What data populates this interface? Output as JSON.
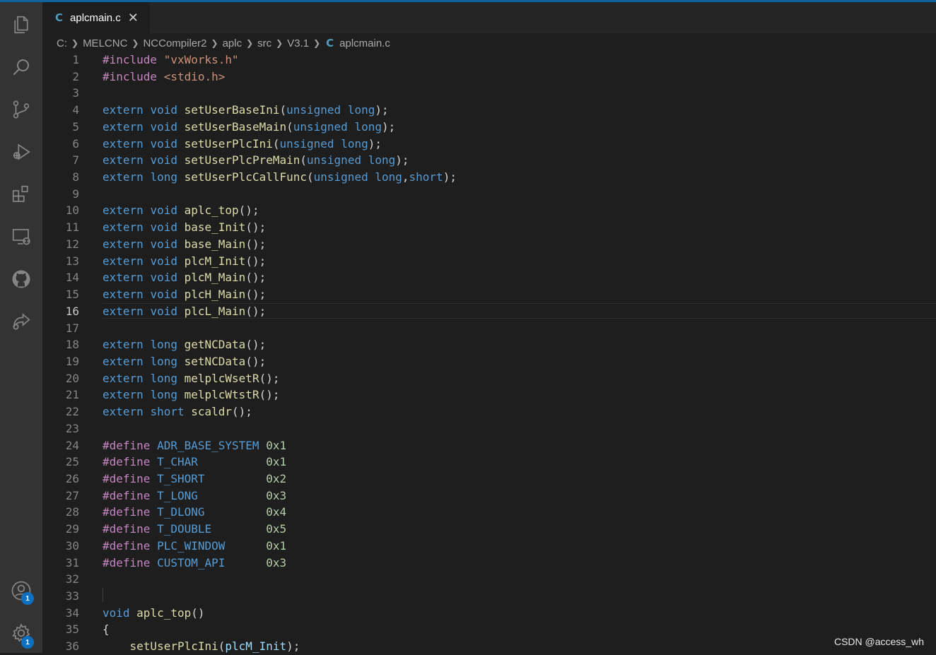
{
  "tab": {
    "icon": "c-language-icon",
    "glyph": "C",
    "filename": "aplcmain.c",
    "close": "✕"
  },
  "breadcrumb": {
    "items": [
      "C:",
      "MELCNC",
      "NCCompiler2",
      "aplc",
      "src",
      "V3.1"
    ],
    "file_glyph": "C",
    "file": "aplcmain.c"
  },
  "activity_bar": {
    "icons": [
      "explorer-icon",
      "search-icon",
      "source-control-icon",
      "run-debug-icon",
      "extensions-icon",
      "remote-explorer-icon",
      "github-icon",
      "live-share-icon",
      "accounts-icon",
      "manage-gear-icon"
    ],
    "accounts_badge": "1",
    "manage_badge": "1"
  },
  "editor": {
    "active_line": 16,
    "lines": [
      {
        "n": "1",
        "tokens": [
          [
            "#include ",
            "pp"
          ],
          [
            "\"vxWorks.h\"",
            "str"
          ]
        ]
      },
      {
        "n": "2",
        "tokens": [
          [
            "#include ",
            "pp"
          ],
          [
            "<stdio.h>",
            "str"
          ]
        ]
      },
      {
        "n": "3",
        "tokens": []
      },
      {
        "n": "4",
        "tokens": [
          [
            "extern ",
            "kw"
          ],
          [
            "void ",
            "kw"
          ],
          [
            "setUserBaseIni",
            "fn"
          ],
          [
            "(",
            "pl"
          ],
          [
            "unsigned ",
            "kw"
          ],
          [
            "long",
            "kw"
          ],
          [
            ");",
            "pl"
          ]
        ]
      },
      {
        "n": "5",
        "tokens": [
          [
            "extern ",
            "kw"
          ],
          [
            "void ",
            "kw"
          ],
          [
            "setUserBaseMain",
            "fn"
          ],
          [
            "(",
            "pl"
          ],
          [
            "unsigned ",
            "kw"
          ],
          [
            "long",
            "kw"
          ],
          [
            ");",
            "pl"
          ]
        ]
      },
      {
        "n": "6",
        "tokens": [
          [
            "extern ",
            "kw"
          ],
          [
            "void ",
            "kw"
          ],
          [
            "setUserPlcIni",
            "fn"
          ],
          [
            "(",
            "pl"
          ],
          [
            "unsigned ",
            "kw"
          ],
          [
            "long",
            "kw"
          ],
          [
            ");",
            "pl"
          ]
        ]
      },
      {
        "n": "7",
        "tokens": [
          [
            "extern ",
            "kw"
          ],
          [
            "void ",
            "kw"
          ],
          [
            "setUserPlcPreMain",
            "fn"
          ],
          [
            "(",
            "pl"
          ],
          [
            "unsigned ",
            "kw"
          ],
          [
            "long",
            "kw"
          ],
          [
            ");",
            "pl"
          ]
        ]
      },
      {
        "n": "8",
        "tokens": [
          [
            "extern ",
            "kw"
          ],
          [
            "long ",
            "kw"
          ],
          [
            "setUserPlcCallFunc",
            "fn"
          ],
          [
            "(",
            "pl"
          ],
          [
            "unsigned ",
            "kw"
          ],
          [
            "long",
            "kw"
          ],
          [
            ",",
            "pl"
          ],
          [
            "short",
            "kw"
          ],
          [
            ");",
            "pl"
          ]
        ]
      },
      {
        "n": "9",
        "tokens": []
      },
      {
        "n": "10",
        "tokens": [
          [
            "extern ",
            "kw"
          ],
          [
            "void ",
            "kw"
          ],
          [
            "aplc_top",
            "fn"
          ],
          [
            "();",
            "pl"
          ]
        ]
      },
      {
        "n": "11",
        "tokens": [
          [
            "extern ",
            "kw"
          ],
          [
            "void ",
            "kw"
          ],
          [
            "base_Init",
            "fn"
          ],
          [
            "();",
            "pl"
          ]
        ]
      },
      {
        "n": "12",
        "tokens": [
          [
            "extern ",
            "kw"
          ],
          [
            "void ",
            "kw"
          ],
          [
            "base_Main",
            "fn"
          ],
          [
            "();",
            "pl"
          ]
        ]
      },
      {
        "n": "13",
        "tokens": [
          [
            "extern ",
            "kw"
          ],
          [
            "void ",
            "kw"
          ],
          [
            "plcM_Init",
            "fn"
          ],
          [
            "();",
            "pl"
          ]
        ]
      },
      {
        "n": "14",
        "tokens": [
          [
            "extern ",
            "kw"
          ],
          [
            "void ",
            "kw"
          ],
          [
            "plcM_Main",
            "fn"
          ],
          [
            "();",
            "pl"
          ]
        ]
      },
      {
        "n": "15",
        "tokens": [
          [
            "extern ",
            "kw"
          ],
          [
            "void ",
            "kw"
          ],
          [
            "plcH_Main",
            "fn"
          ],
          [
            "();",
            "pl"
          ]
        ]
      },
      {
        "n": "16",
        "tokens": [
          [
            "extern ",
            "kw"
          ],
          [
            "void ",
            "kw"
          ],
          [
            "plcL_Main",
            "fn"
          ],
          [
            "();",
            "pl"
          ]
        ]
      },
      {
        "n": "17",
        "tokens": []
      },
      {
        "n": "18",
        "tokens": [
          [
            "extern ",
            "kw"
          ],
          [
            "long ",
            "kw"
          ],
          [
            "getNCData",
            "fn"
          ],
          [
            "();",
            "pl"
          ]
        ]
      },
      {
        "n": "19",
        "tokens": [
          [
            "extern ",
            "kw"
          ],
          [
            "long ",
            "kw"
          ],
          [
            "setNCData",
            "fn"
          ],
          [
            "();",
            "pl"
          ]
        ]
      },
      {
        "n": "20",
        "tokens": [
          [
            "extern ",
            "kw"
          ],
          [
            "long ",
            "kw"
          ],
          [
            "melplcWsetR",
            "fn"
          ],
          [
            "();",
            "pl"
          ]
        ]
      },
      {
        "n": "21",
        "tokens": [
          [
            "extern ",
            "kw"
          ],
          [
            "long ",
            "kw"
          ],
          [
            "melplcWtstR",
            "fn"
          ],
          [
            "();",
            "pl"
          ]
        ]
      },
      {
        "n": "22",
        "tokens": [
          [
            "extern ",
            "kw"
          ],
          [
            "short ",
            "kw"
          ],
          [
            "scaldr",
            "fn"
          ],
          [
            "();",
            "pl"
          ]
        ]
      },
      {
        "n": "23",
        "tokens": []
      },
      {
        "n": "24",
        "tokens": [
          [
            "#define ",
            "pp"
          ],
          [
            "ADR_BASE_SYSTEM ",
            "mac"
          ],
          [
            "0x1",
            "num"
          ]
        ]
      },
      {
        "n": "25",
        "tokens": [
          [
            "#define ",
            "pp"
          ],
          [
            "T_CHAR          ",
            "mac"
          ],
          [
            "0x1",
            "num"
          ]
        ]
      },
      {
        "n": "26",
        "tokens": [
          [
            "#define ",
            "pp"
          ],
          [
            "T_SHORT         ",
            "mac"
          ],
          [
            "0x2",
            "num"
          ]
        ]
      },
      {
        "n": "27",
        "tokens": [
          [
            "#define ",
            "pp"
          ],
          [
            "T_LONG          ",
            "mac"
          ],
          [
            "0x3",
            "num"
          ]
        ]
      },
      {
        "n": "28",
        "tokens": [
          [
            "#define ",
            "pp"
          ],
          [
            "T_DLONG         ",
            "mac"
          ],
          [
            "0x4",
            "num"
          ]
        ]
      },
      {
        "n": "29",
        "tokens": [
          [
            "#define ",
            "pp"
          ],
          [
            "T_DOUBLE        ",
            "mac"
          ],
          [
            "0x5",
            "num"
          ]
        ]
      },
      {
        "n": "30",
        "tokens": [
          [
            "#define ",
            "pp"
          ],
          [
            "PLC_WINDOW      ",
            "mac"
          ],
          [
            "0x1",
            "num"
          ]
        ]
      },
      {
        "n": "31",
        "tokens": [
          [
            "#define ",
            "pp"
          ],
          [
            "CUSTOM_API      ",
            "mac"
          ],
          [
            "0x3",
            "num"
          ]
        ]
      },
      {
        "n": "32",
        "tokens": []
      },
      {
        "n": "33",
        "tokens": []
      },
      {
        "n": "34",
        "tokens": [
          [
            "void ",
            "kw"
          ],
          [
            "aplc_top",
            "fn"
          ],
          [
            "()",
            "pl"
          ]
        ]
      },
      {
        "n": "35",
        "tokens": [
          [
            "{",
            "pl"
          ]
        ]
      },
      {
        "n": "36",
        "tokens": [
          [
            "    ",
            "pl"
          ],
          [
            "setUserPlcIni",
            "fn"
          ],
          [
            "(",
            "pl"
          ],
          [
            "plcM_Init",
            "var"
          ],
          [
            ");",
            "pl"
          ]
        ]
      }
    ]
  },
  "watermark": "CSDN @access_wh"
}
